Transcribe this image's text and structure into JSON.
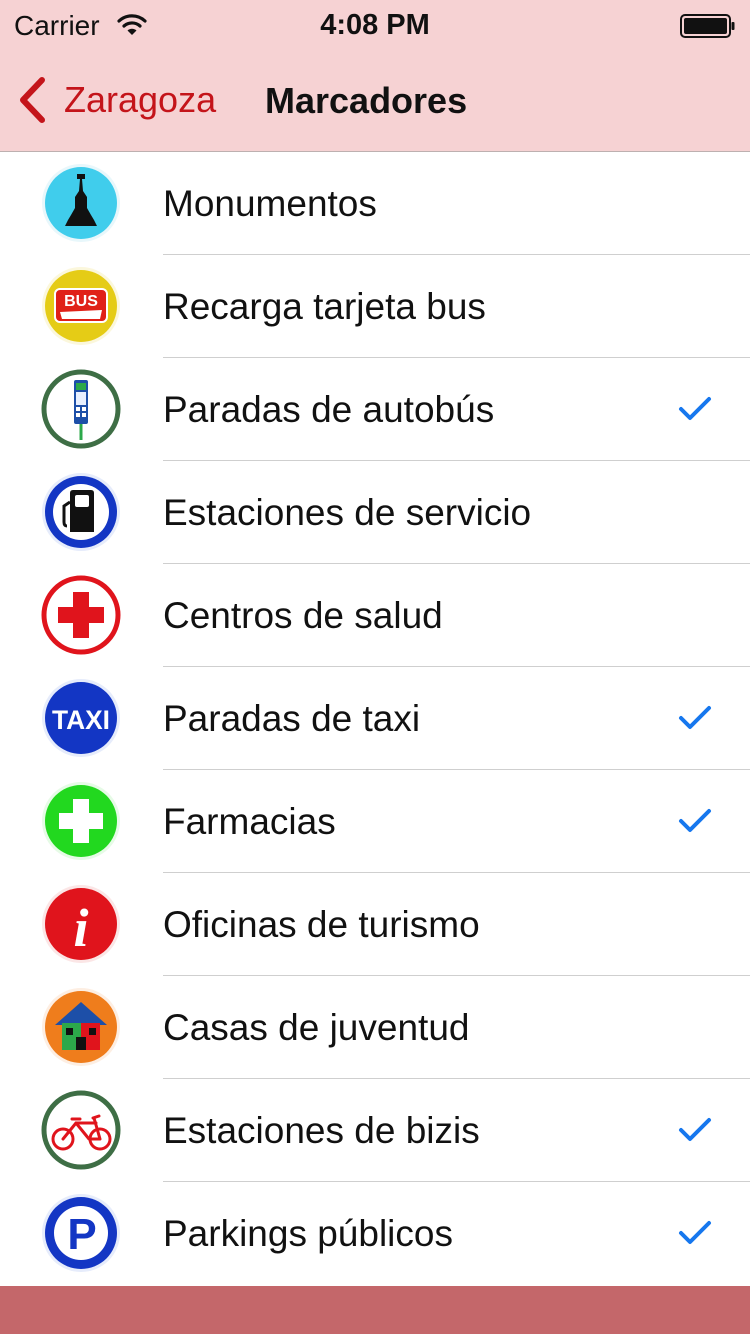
{
  "status_bar": {
    "carrier": "Carrier",
    "time": "4:08 PM"
  },
  "nav": {
    "back_label": "Zaragoza",
    "title": "Marcadores"
  },
  "theme": {
    "header_bg": "#f6d2d3",
    "accent": "#c4141a",
    "check_color": "#1677ee",
    "footer_bg": "#c4676a"
  },
  "items": [
    {
      "label": "Monumentos",
      "icon": "monument-icon",
      "checked": false
    },
    {
      "label": "Recarga tarjeta bus",
      "icon": "bus-card-icon",
      "checked": false
    },
    {
      "label": "Paradas de autobús",
      "icon": "bus-stop-icon",
      "checked": true
    },
    {
      "label": "Estaciones de servicio",
      "icon": "gas-station-icon",
      "checked": false
    },
    {
      "label": "Centros de salud",
      "icon": "health-center-icon",
      "checked": false
    },
    {
      "label": "Paradas de taxi",
      "icon": "taxi-icon",
      "checked": true
    },
    {
      "label": "Farmacias",
      "icon": "pharmacy-icon",
      "checked": true
    },
    {
      "label": "Oficinas de turismo",
      "icon": "tourism-info-icon",
      "checked": false
    },
    {
      "label": "Casas de juventud",
      "icon": "youth-house-icon",
      "checked": false
    },
    {
      "label": "Estaciones de bizis",
      "icon": "bike-station-icon",
      "checked": true
    },
    {
      "label": "Parkings públicos",
      "icon": "parking-icon",
      "checked": true
    }
  ],
  "icon_text": {
    "bus": "BUS",
    "taxi": "TAXI",
    "info": "i",
    "parking": "P"
  }
}
